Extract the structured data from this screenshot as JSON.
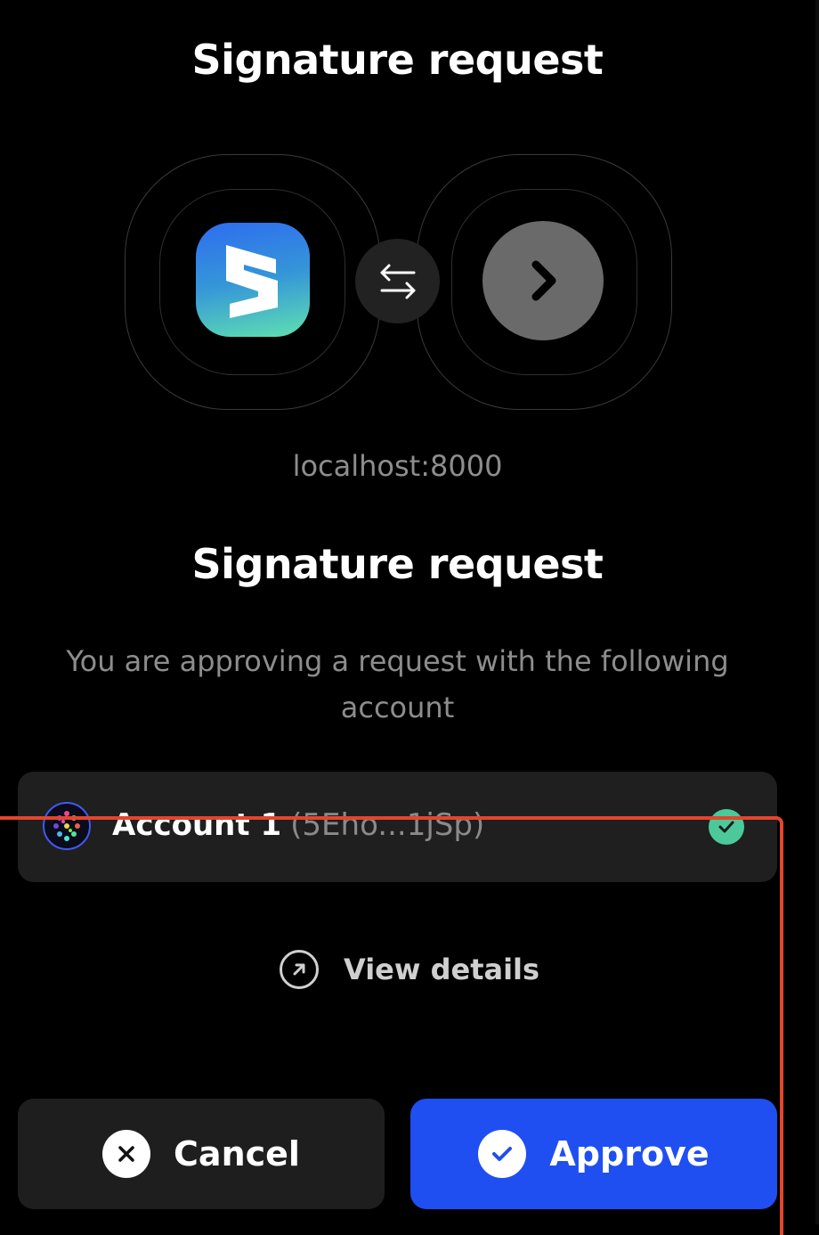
{
  "header": {
    "title": "Signature request"
  },
  "connection": {
    "app_icon": "subwallet-logo-icon",
    "swap_icon": "swap-arrows-icon",
    "site_icon": "chevron-right-icon",
    "host": "localhost:8000"
  },
  "request": {
    "title": "Signature request",
    "description": "You are approving a request with the following account"
  },
  "account": {
    "name": "Account 1",
    "address": "(5Eho...1jSp)",
    "selected_icon": "check-circle-icon"
  },
  "view_details": {
    "label": "View details",
    "icon": "arrow-up-right-circle-icon"
  },
  "actions": {
    "cancel_label": "Cancel",
    "approve_label": "Approve"
  },
  "colors": {
    "background": "#000000",
    "approve": "#1f4ff0",
    "check": "#4cc99a",
    "highlight": "#e3452d"
  }
}
